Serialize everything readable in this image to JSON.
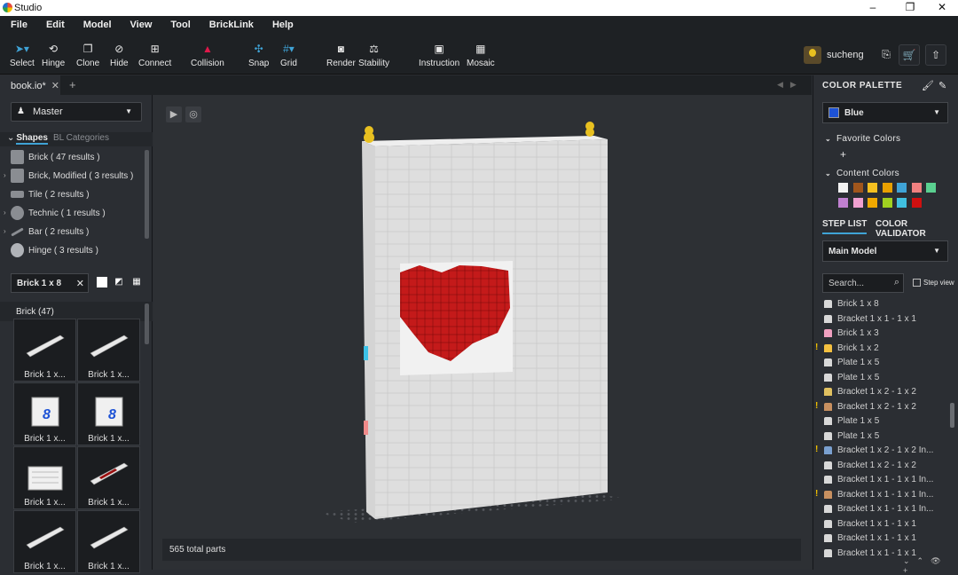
{
  "window": {
    "title": "Studio",
    "min": "–",
    "restore": "❐",
    "close": "✕"
  },
  "menu": [
    "File",
    "Edit",
    "Model",
    "View",
    "Tool",
    "BrickLink",
    "Help"
  ],
  "toolbar": [
    {
      "label": "Select",
      "icon": "cursor-icon"
    },
    {
      "label": "Hinge",
      "icon": "hinge-icon"
    },
    {
      "label": "Clone",
      "icon": "clone-icon"
    },
    {
      "label": "Hide",
      "icon": "hide-icon"
    },
    {
      "label": "Connect",
      "icon": "connect-icon"
    },
    {
      "label": "Collision",
      "icon": "collision-icon"
    },
    {
      "label": "Snap",
      "icon": "snap-icon"
    },
    {
      "label": "Grid",
      "icon": "grid-icon"
    },
    {
      "label": "Render",
      "icon": "camera-icon"
    },
    {
      "label": "Stability",
      "icon": "stability-icon"
    },
    {
      "label": "Instruction",
      "icon": "instruction-icon"
    },
    {
      "label": "Mosaic",
      "icon": "mosaic-icon"
    }
  ],
  "user": {
    "name": "sucheng"
  },
  "tabs": {
    "active": "book.io*",
    "close": "✕",
    "add": "+"
  },
  "left": {
    "master": "Master",
    "shape_tabs": {
      "shapes": "Shapes",
      "bl": "BL Categories"
    },
    "categories": [
      {
        "label": "Brick ( 47 results )",
        "expand": false
      },
      {
        "label": "Brick, Modified ( 3 results )",
        "expand": true
      },
      {
        "label": "Tile ( 2 results )",
        "expand": false
      },
      {
        "label": "Technic ( 1 results )",
        "expand": true
      },
      {
        "label": "Bar ( 2 results )",
        "expand": true
      },
      {
        "label": "Hinge ( 3 results )",
        "expand": false
      }
    ],
    "search_value": "Brick 1 x 8",
    "search_clear": "✕",
    "brick_header": "Brick (47)",
    "tiles": [
      "Brick 1 x...",
      "Brick 1 x...",
      "Brick 1 x...",
      "Brick 1 x...",
      "Brick 1 x...",
      "Brick 1 x...",
      "Brick 1 x...",
      "Brick 1 x..."
    ]
  },
  "viewport": {
    "total_parts": "565 total parts"
  },
  "right": {
    "color_palette": "COLOR PALETTE",
    "selected_color": "Blue",
    "selected_hex": "#1d52d6",
    "favorite": "Favorite Colors",
    "favorite_add": "+",
    "content": "Content Colors",
    "content_colors": [
      "#f2f2f2",
      "#a0561c",
      "#f4c020",
      "#e8a000",
      "#3fa3d6",
      "#f08080",
      "#5ad090",
      "#c080d0",
      "#f0a0d0",
      "#f0a800",
      "#a0d020",
      "#40c0e0",
      "#d01010"
    ],
    "step_tab": "STEP LIST",
    "validator_tab": "COLOR VALIDATOR",
    "model": "Main Model",
    "search_placeholder": "Search...",
    "step_view": "Step view",
    "steps": [
      {
        "label": "Brick 1 x 8",
        "color": "#d8d8d8",
        "warn": false
      },
      {
        "label": "Bracket 1 x 1 - 1 x 1",
        "color": "#d8d8d8",
        "warn": false
      },
      {
        "label": "Brick 1 x 3",
        "color": "#f0a0c0",
        "warn": false
      },
      {
        "label": "Brick 1 x 2",
        "color": "#f4c040",
        "warn": true
      },
      {
        "label": "Plate 1 x 5",
        "color": "#d8d8d8",
        "warn": false
      },
      {
        "label": "Plate 1 x 5",
        "color": "#d8d8d8",
        "warn": false
      },
      {
        "label": "Bracket 1 x 2 - 1 x 2",
        "color": "#e0c060",
        "warn": false
      },
      {
        "label": "Bracket 1 x 2 - 1 x 2",
        "color": "#c89060",
        "warn": true
      },
      {
        "label": "Plate 1 x 5",
        "color": "#d8d8d8",
        "warn": false
      },
      {
        "label": "Plate 1 x 5",
        "color": "#d8d8d8",
        "warn": false
      },
      {
        "label": "Bracket 1 x 2 - 1 x 2 In...",
        "color": "#7aa0d0",
        "warn": true
      },
      {
        "label": "Bracket 1 x 2 - 1 x 2",
        "color": "#d8d8d8",
        "warn": false
      },
      {
        "label": "Bracket 1 x 1 - 1 x 1 In...",
        "color": "#d8d8d8",
        "warn": false
      },
      {
        "label": "Bracket 1 x 1 - 1 x 1 In...",
        "color": "#c89060",
        "warn": true
      },
      {
        "label": "Bracket 1 x 1 - 1 x 1 In...",
        "color": "#d8d8d8",
        "warn": false
      },
      {
        "label": "Bracket 1 x 1 - 1 x 1",
        "color": "#d8d8d8",
        "warn": false
      },
      {
        "label": "Bracket 1 x 1 - 1 x 1",
        "color": "#d8d8d8",
        "warn": false
      },
      {
        "label": "Bracket 1 x 1 - 1 x 1",
        "color": "#d8d8d8",
        "warn": false
      }
    ]
  }
}
